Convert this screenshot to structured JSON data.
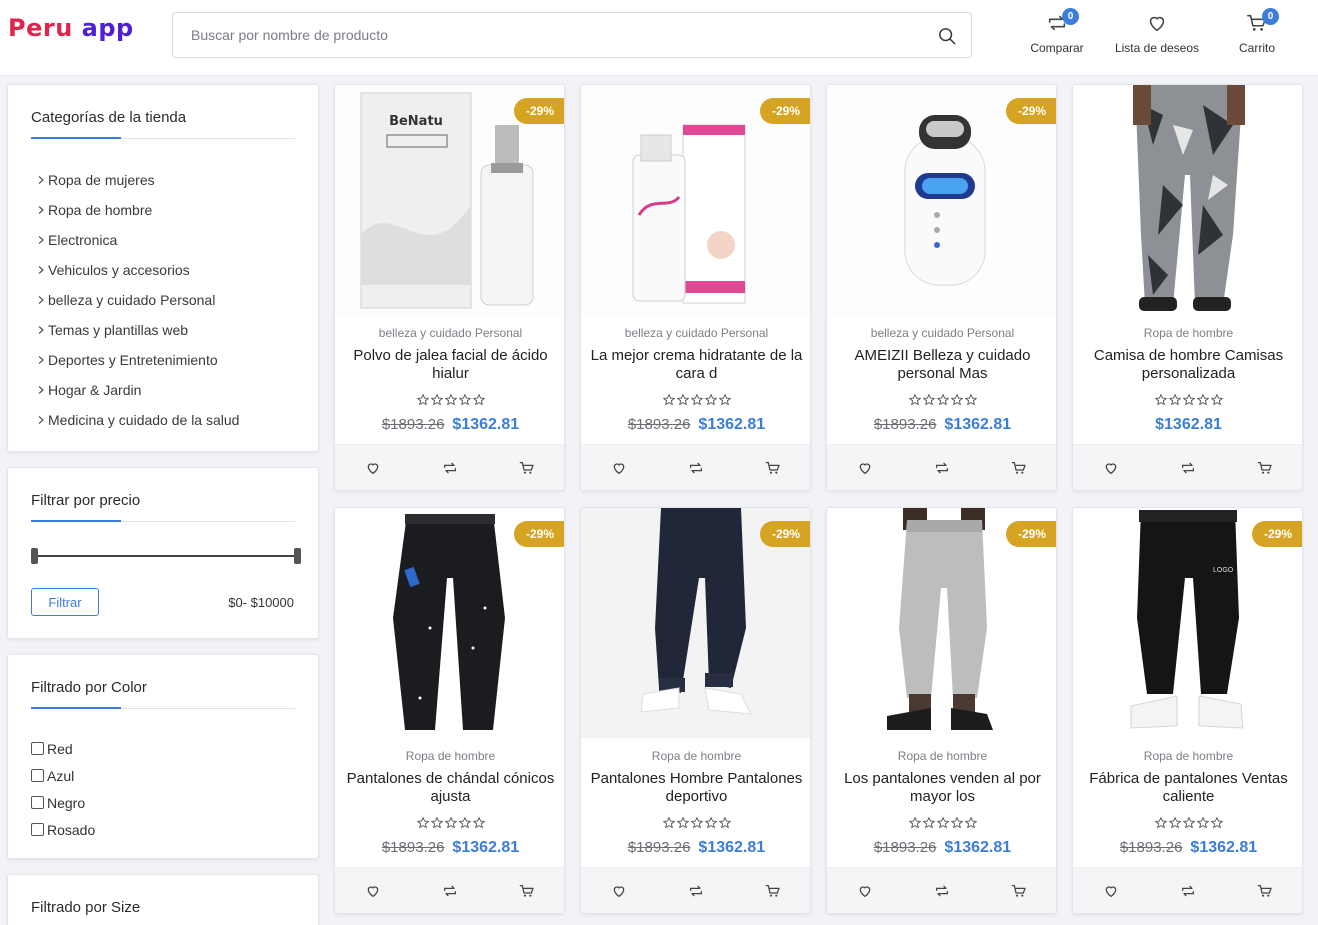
{
  "header": {
    "logo_part1": "Peru",
    "logo_part2": "app",
    "search_placeholder": "Buscar por nombre de producto",
    "compare_label": "Comparar",
    "compare_count": "0",
    "wishlist_label": "Lista de deseos",
    "cart_label": "Carrito",
    "cart_count": "0"
  },
  "categories": {
    "title": "Categorías de la tienda",
    "items": [
      "Ropa de mujeres",
      "Ropa de hombre",
      "Electronica",
      "Vehiculos y accesorios",
      "belleza y cuidado Personal",
      "Temas y plantillas web",
      "Deportes y Entretenimiento",
      "Hogar & Jardin",
      "Medicina y cuidado de la salud"
    ]
  },
  "price_filter": {
    "title": "Filtrar por precio",
    "button_label": "Filtrar",
    "range_text": "$0- $10000",
    "min_fraction": 0,
    "max_fraction": 1
  },
  "color_filter": {
    "title": "Filtrado por Color",
    "options": [
      "Red",
      "Azul",
      "Negro",
      "Rosado"
    ]
  },
  "size_filter": {
    "title": "Filtrado por Size"
  },
  "products": [
    {
      "category": "belleza y cuidado Personal",
      "name": "Polvo de jalea facial de ácido hialur",
      "discount": "-29%",
      "old_price": "$1893.26",
      "new_price": "$1362.81",
      "rating": 0,
      "image": "serum-box"
    },
    {
      "category": "belleza y cuidado Personal",
      "name": "La mejor crema hidratante de la cara d",
      "discount": "-29%",
      "old_price": "$1893.26",
      "new_price": "$1362.81",
      "rating": 0,
      "image": "cream-box"
    },
    {
      "category": "belleza y cuidado Personal",
      "name": "AMEIZII Belleza y cuidado personal Mas",
      "discount": "-29%",
      "old_price": "$1893.26",
      "new_price": "$1362.81",
      "rating": 0,
      "image": "face-device"
    },
    {
      "category": "Ropa de hombre",
      "name": "Camisa de hombre Camisas personalizada",
      "discount": "",
      "old_price": "",
      "new_price": "$1362.81",
      "rating": 0,
      "image": "camo-pants"
    },
    {
      "category": "Ropa de hombre",
      "name": "Pantalones de chándal cónicos ajusta",
      "discount": "-29%",
      "old_price": "$1893.26",
      "new_price": "$1362.81",
      "rating": 0,
      "image": "black-jeans"
    },
    {
      "category": "Ropa de hombre",
      "name": "Pantalones Hombre Pantalones deportivo",
      "discount": "-29%",
      "old_price": "$1893.26",
      "new_price": "$1362.81",
      "rating": 0,
      "image": "navy-joggers"
    },
    {
      "category": "Ropa de hombre",
      "name": "Los pantalones venden al por mayor los",
      "discount": "-29%",
      "old_price": "$1893.26",
      "new_price": "$1362.81",
      "rating": 0,
      "image": "grey-joggers"
    },
    {
      "category": "Ropa de hombre",
      "name": "Fábrica de pantalones Ventas caliente",
      "discount": "-29%",
      "old_price": "$1893.26",
      "new_price": "$1362.81",
      "rating": 0,
      "image": "black-joggers",
      "image_text": "LOGO"
    }
  ],
  "colors": {
    "accent": "#3b7ddd",
    "discount_badge": "#d6a423",
    "logo_red": "#e0254d",
    "logo_purple": "#4f1fd8"
  }
}
